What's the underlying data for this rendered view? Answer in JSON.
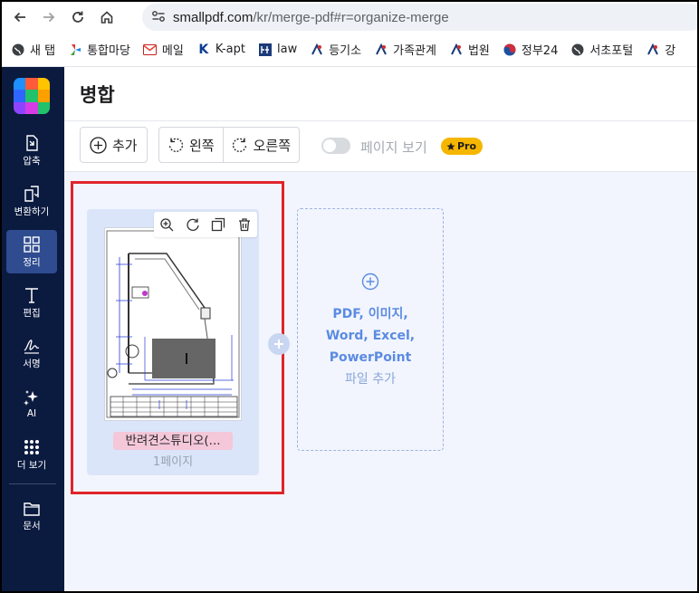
{
  "browser": {
    "url_host": "smallpdf.com",
    "url_path": "/kr/merge-pdf#r=organize-merge",
    "nav_icons": [
      "back-arrow-icon",
      "forward-arrow-icon",
      "reload-icon",
      "home-icon",
      "site-info-icon"
    ]
  },
  "bookmarks": [
    {
      "label": "새 탭",
      "icon": "globe-icon"
    },
    {
      "label": "통합마당",
      "icon": "pinwheel-icon"
    },
    {
      "label": "메일",
      "icon": "gmail-icon"
    },
    {
      "label": "K-apt",
      "icon": "k-logo-icon"
    },
    {
      "label": "law",
      "icon": "law-icon"
    },
    {
      "label": "등기소",
      "icon": "court-icon"
    },
    {
      "label": "가족관계",
      "icon": "court-icon"
    },
    {
      "label": "법원",
      "icon": "court-icon"
    },
    {
      "label": "정부24",
      "icon": "taegeuk-icon"
    },
    {
      "label": "서초포털",
      "icon": "globe-icon"
    },
    {
      "label": "강",
      "icon": "court-icon"
    }
  ],
  "sidebar": {
    "items": [
      {
        "label": "압축",
        "icon": "compress-icon"
      },
      {
        "label": "변환하기",
        "icon": "convert-icon"
      },
      {
        "label": "정리",
        "icon": "grid-icon",
        "active": true
      },
      {
        "label": "편집",
        "icon": "text-icon"
      },
      {
        "label": "서명",
        "icon": "signature-icon"
      },
      {
        "label": "AI",
        "icon": "sparkle-icon"
      },
      {
        "label": "더 보기",
        "icon": "dots-grid-icon"
      },
      {
        "label": "문서",
        "icon": "folder-icon"
      }
    ]
  },
  "header": {
    "title": "병합"
  },
  "toolbar": {
    "add_label": "추가",
    "rotate_left_label": "왼쪽",
    "rotate_right_label": "오른쪽",
    "page_view_label": "페이지 보기",
    "page_view_on": false,
    "pro_badge": "Pro",
    "pro_color": "#f5b600"
  },
  "files": [
    {
      "name": "반려견스튜디오(...",
      "pages": "1페이지",
      "tools": [
        "zoom-in-icon",
        "rotate-icon",
        "duplicate-icon",
        "trash-icon"
      ]
    }
  ],
  "add_zone": {
    "line1_a": "PDF",
    "line1_sep": ", ",
    "line1_b": "이미지",
    "line1_end": ",",
    "line2_a": "Word",
    "line2_sep": ", ",
    "line2_b": "Excel",
    "line2_end": ",",
    "line3": "PowerPoint",
    "sub": "파일 추가"
  },
  "colors": {
    "sidebar_bg": "#0b1a3f",
    "sidebar_active": "#2e4c8f",
    "accent_blue": "#5b8be2",
    "highlight_red": "#e1242c"
  }
}
